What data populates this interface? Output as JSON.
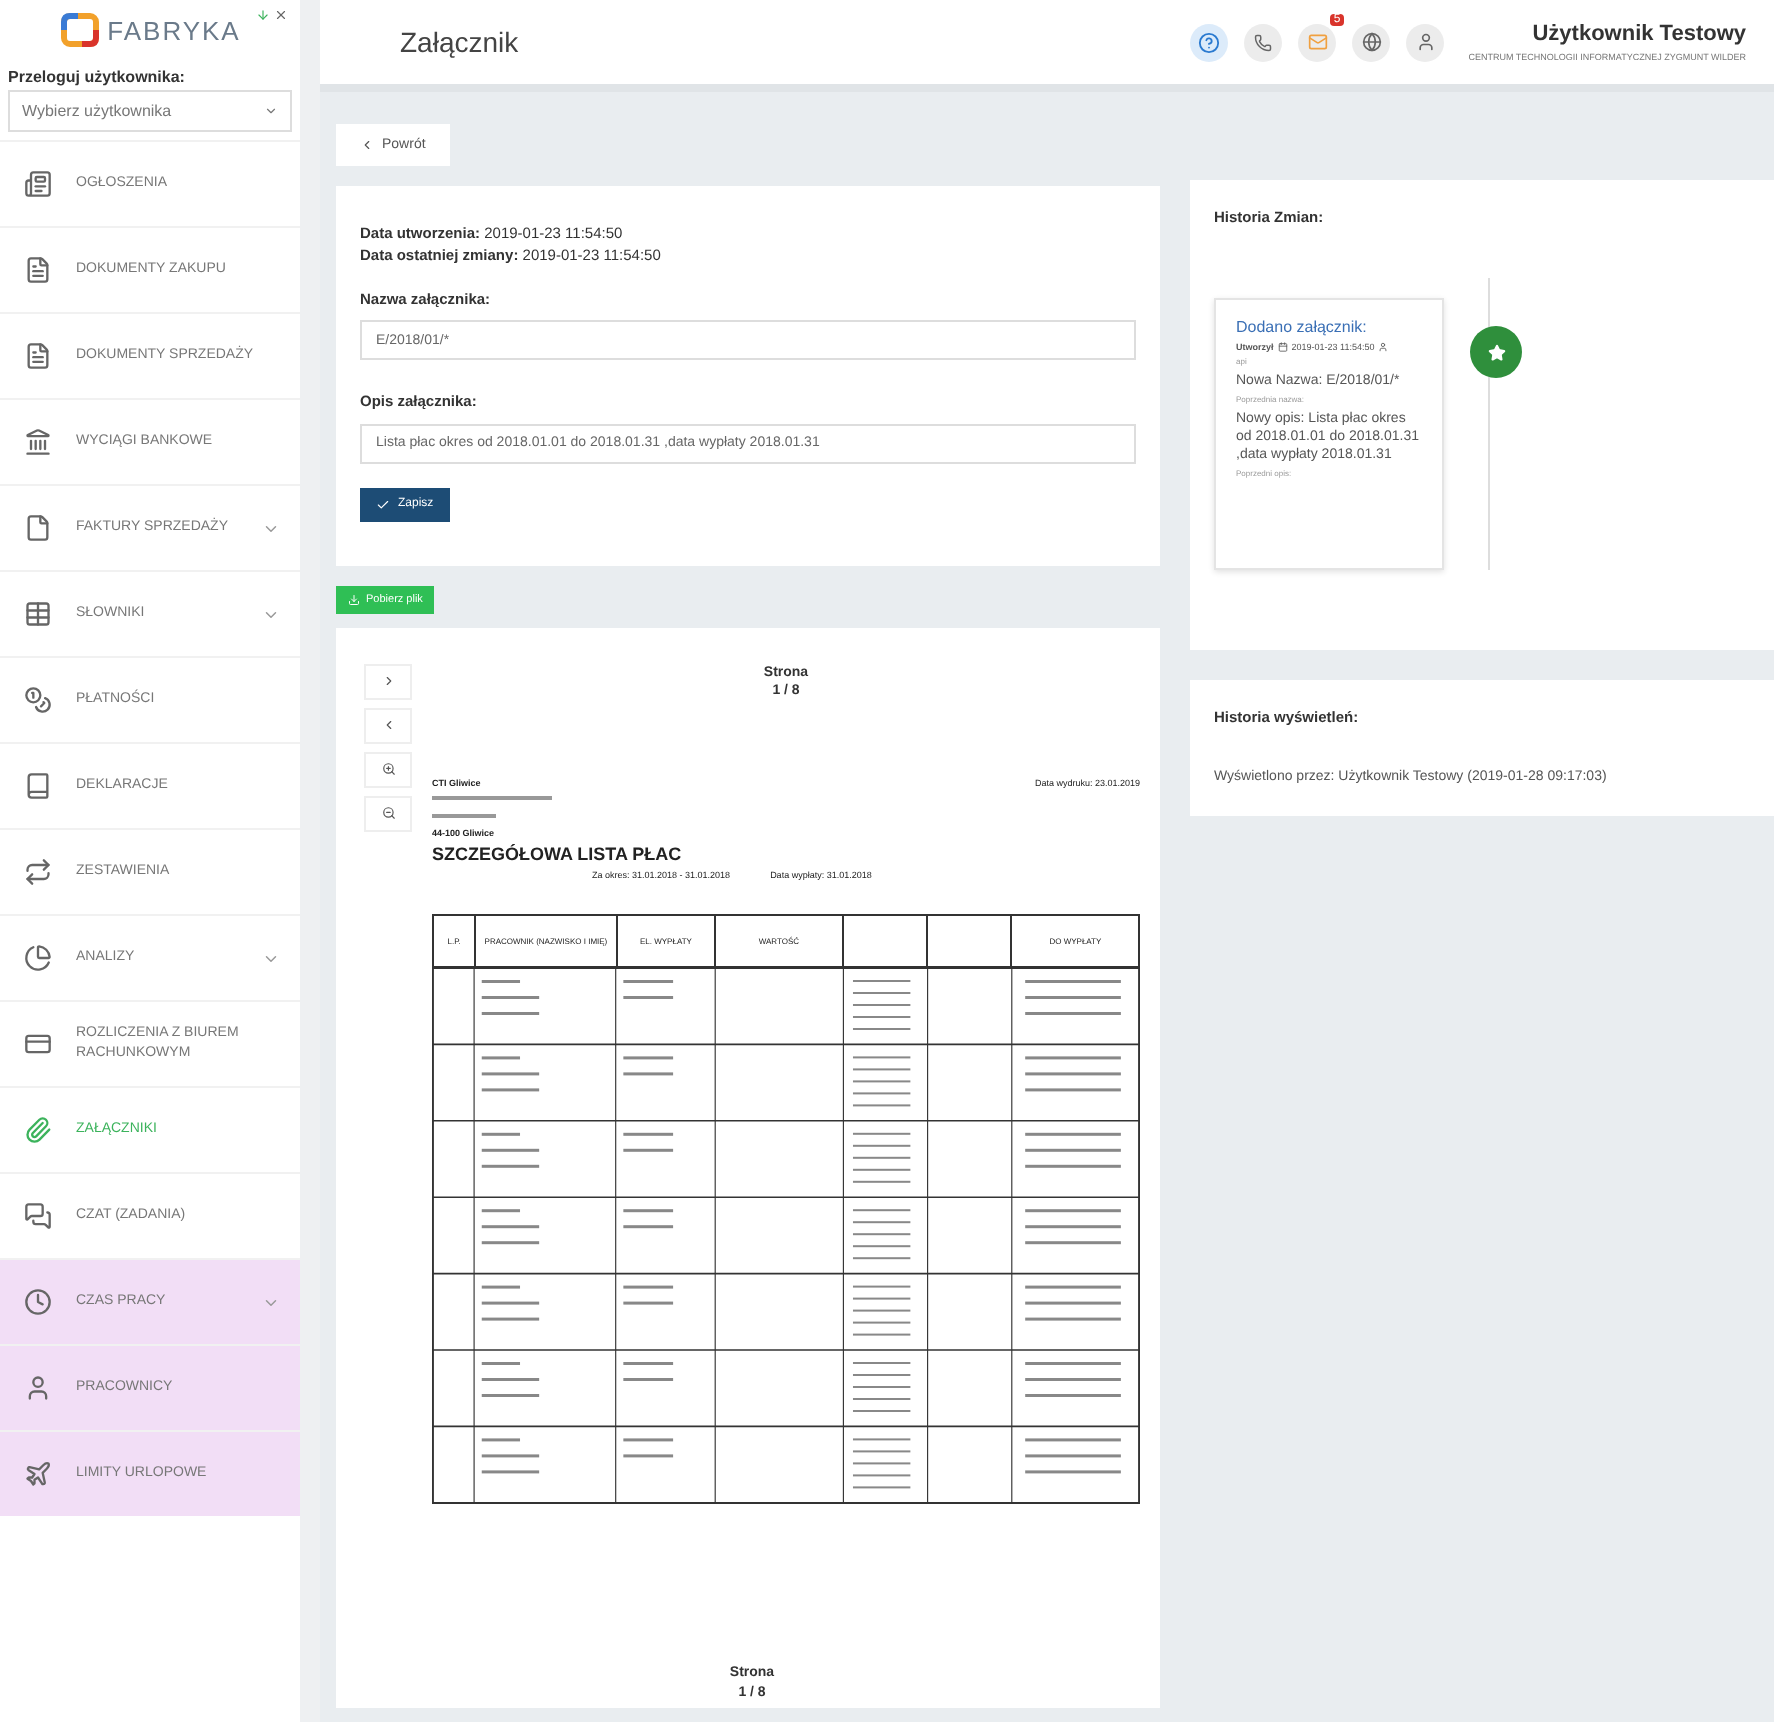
{
  "sidebar": {
    "logo": "FABRYKA",
    "relogin_label": "Przeloguj użytkownika:",
    "user_select": {
      "placeholder": "Wybierz użytkownika"
    },
    "items": [
      {
        "label": "OGŁOSZENIA",
        "selected": false,
        "expandable": false,
        "highlighted": false
      },
      {
        "label": "DOKUMENTY ZAKUPU",
        "selected": false,
        "expandable": false,
        "highlighted": false
      },
      {
        "label": "DOKUMENTY SPRZEDAŻY",
        "selected": false,
        "expandable": false,
        "highlighted": false
      },
      {
        "label": "WYCIĄGI BANKOWE",
        "selected": false,
        "expandable": false,
        "highlighted": false
      },
      {
        "label": "FAKTURY SPRZEDAŻY",
        "selected": false,
        "expandable": true,
        "highlighted": false
      },
      {
        "label": "SŁOWNIKI",
        "selected": false,
        "expandable": true,
        "highlighted": false
      },
      {
        "label": "PŁATNOŚCI",
        "selected": false,
        "expandable": false,
        "highlighted": false
      },
      {
        "label": "DEKLARACJE",
        "selected": false,
        "expandable": false,
        "highlighted": false
      },
      {
        "label": "ZESTAWIENIA",
        "selected": false,
        "expandable": false,
        "highlighted": false
      },
      {
        "label": "ANALIZY",
        "selected": false,
        "expandable": true,
        "highlighted": false
      },
      {
        "label": "ROZLICZENIA Z BIUREM RACHUNKOWYM",
        "selected": false,
        "expandable": false,
        "highlighted": false
      },
      {
        "label": "ZAŁĄCZNIKI",
        "selected": true,
        "expandable": false,
        "highlighted": false
      },
      {
        "label": "CZAT (ZADANIA)",
        "selected": false,
        "expandable": false,
        "highlighted": false
      },
      {
        "label": "CZAS PRACY",
        "selected": false,
        "expandable": true,
        "highlighted": true
      },
      {
        "label": "PRACOWNICY",
        "selected": false,
        "expandable": false,
        "highlighted": true
      },
      {
        "label": "LIMITY URLOPOWE",
        "selected": false,
        "expandable": false,
        "highlighted": true
      }
    ]
  },
  "header": {
    "title": "Załącznik",
    "mail_badge": "5",
    "user_name": "Użytkownik Testowy",
    "company": "CENTRUM TECHNOLOGII INFORMATYCZNEJ ZYGMUNT WILDER"
  },
  "back_button": "Powrót",
  "form": {
    "created_label": "Data utworzenia:",
    "created": "2019-01-23 11:54:50",
    "modified_label": "Data ostatniej zmiany:",
    "modified": "2019-01-23 11:54:50",
    "name_label": "Nazwa załącznika:",
    "name_value": "E/2018/01/*",
    "description_label": "Opis załącznika:",
    "description_value": "Lista płac okres od 2018.01.01 do 2018.01.31 ,data wypłaty 2018.01.31",
    "save_button": "Zapisz"
  },
  "download_button": "Pobierz plik",
  "viewer": {
    "page_label": "Strona",
    "page_number": "1 / 8",
    "document": {
      "company": "CTI Gliwice",
      "city": "44-100 Gliwice",
      "print_date": "Data wydruku:  23.01.2019",
      "title": "SZCZEGÓŁOWA LISTA PŁAC",
      "period": "Za okres:    31.01.2018  -  31.01.2018",
      "payout_date": "Data wypłaty:  31.01.2018",
      "columns": [
        "L.P.",
        "PRACOWNIK (NAZWISKO I IMIĘ)",
        "EL. WYPŁATY",
        "WARTOŚĆ",
        "",
        "",
        "DO WYPŁATY"
      ]
    },
    "footer_page_label": "Strona",
    "footer_page_number": "1 / 8"
  },
  "history": {
    "title": "Historia Zmian:",
    "entries": [
      {
        "title": "Dodano załącznik:",
        "author_label": "Utworzył",
        "date": "2019-01-23 11:54:50",
        "user": "api",
        "new_name": "Nowa Nazwa: E/2018/01/*",
        "previous_name": "Poprzednia nazwa:",
        "new_description": "Nowy opis: Lista płac okres od 2018.01.01 do 2018.01.31 ,data wypłaty 2018.01.31",
        "previous_description": "Poprzedni opis:"
      }
    ]
  },
  "views": {
    "title": "Historia wyświetleń:",
    "entries": [
      "Wyświetlono przez: Użytkownik Testowy (2019-01-28 09:17:03)"
    ]
  }
}
